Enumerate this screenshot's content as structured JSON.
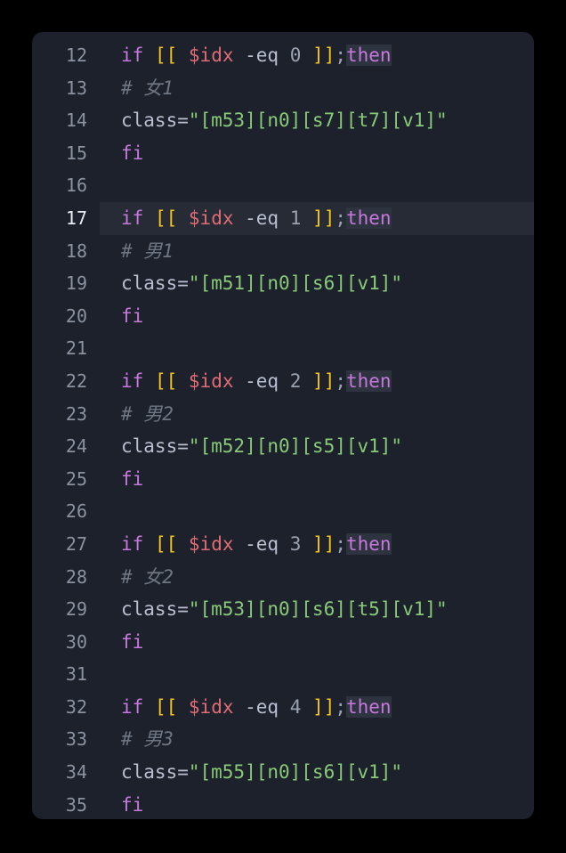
{
  "editor": {
    "background_color": "#1d212b",
    "page_background_color": "#000000",
    "active_line_number": 17,
    "first_line_number": 12,
    "last_line_number": 35,
    "language": "bash",
    "colors": {
      "keyword": "#c678dd",
      "bracket": "#f5c518",
      "variable": "#e06c75",
      "operator": "#b9bfd0",
      "number": "#9aa2b1",
      "string": "#89ca78",
      "comment": "#6f7683",
      "line_number": "#8b92a0",
      "line_number_active": "#e8ebf2",
      "active_line_background": "#272b35",
      "match_highlight_background": "#2e3340"
    }
  },
  "lines": [
    {
      "number": "12",
      "active": false,
      "tokens": [
        {
          "t": "if",
          "c": "kw"
        },
        {
          "t": " ",
          "c": "plain"
        },
        {
          "t": "[[",
          "c": "brkt"
        },
        {
          "t": " ",
          "c": "plain"
        },
        {
          "t": "$idx",
          "c": "var"
        },
        {
          "t": " ",
          "c": "plain"
        },
        {
          "t": "-eq",
          "c": "op"
        },
        {
          "t": " ",
          "c": "plain"
        },
        {
          "t": "0",
          "c": "num"
        },
        {
          "t": " ",
          "c": "plain"
        },
        {
          "t": "]]",
          "c": "brkt"
        },
        {
          "t": ";",
          "c": "punct"
        },
        {
          "t": "then",
          "c": "kw-hl"
        }
      ]
    },
    {
      "number": "13",
      "active": false,
      "tokens": [
        {
          "t": "# 女1",
          "c": "comment"
        }
      ]
    },
    {
      "number": "14",
      "active": false,
      "tokens": [
        {
          "t": "class=",
          "c": "plain"
        },
        {
          "t": "\"[m53][n0][s7][t7][v1]\"",
          "c": "str"
        }
      ]
    },
    {
      "number": "15",
      "active": false,
      "tokens": [
        {
          "t": "fi",
          "c": "kw"
        }
      ]
    },
    {
      "number": "16",
      "active": false,
      "tokens": []
    },
    {
      "number": "17",
      "active": true,
      "tokens": [
        {
          "t": "if",
          "c": "kw"
        },
        {
          "t": " ",
          "c": "plain"
        },
        {
          "t": "[[",
          "c": "brkt"
        },
        {
          "t": " ",
          "c": "plain"
        },
        {
          "t": "$idx",
          "c": "var"
        },
        {
          "t": " ",
          "c": "plain"
        },
        {
          "t": "-eq",
          "c": "op"
        },
        {
          "t": " ",
          "c": "plain"
        },
        {
          "t": "1",
          "c": "num"
        },
        {
          "t": " ",
          "c": "plain"
        },
        {
          "t": "]]",
          "c": "brkt"
        },
        {
          "t": ";",
          "c": "punct"
        },
        {
          "t": "then",
          "c": "kw-hl"
        }
      ]
    },
    {
      "number": "18",
      "active": false,
      "tokens": [
        {
          "t": "# 男1",
          "c": "comment"
        }
      ]
    },
    {
      "number": "19",
      "active": false,
      "tokens": [
        {
          "t": "class=",
          "c": "plain"
        },
        {
          "t": "\"[m51][n0][s6][v1]\"",
          "c": "str"
        }
      ]
    },
    {
      "number": "20",
      "active": false,
      "tokens": [
        {
          "t": "fi",
          "c": "kw"
        }
      ]
    },
    {
      "number": "21",
      "active": false,
      "tokens": []
    },
    {
      "number": "22",
      "active": false,
      "tokens": [
        {
          "t": "if",
          "c": "kw"
        },
        {
          "t": " ",
          "c": "plain"
        },
        {
          "t": "[[",
          "c": "brkt"
        },
        {
          "t": " ",
          "c": "plain"
        },
        {
          "t": "$idx",
          "c": "var"
        },
        {
          "t": " ",
          "c": "plain"
        },
        {
          "t": "-eq",
          "c": "op"
        },
        {
          "t": " ",
          "c": "plain"
        },
        {
          "t": "2",
          "c": "num"
        },
        {
          "t": " ",
          "c": "plain"
        },
        {
          "t": "]]",
          "c": "brkt"
        },
        {
          "t": ";",
          "c": "punct"
        },
        {
          "t": "then",
          "c": "kw-hl"
        }
      ]
    },
    {
      "number": "23",
      "active": false,
      "tokens": [
        {
          "t": "# 男2",
          "c": "comment"
        }
      ]
    },
    {
      "number": "24",
      "active": false,
      "tokens": [
        {
          "t": "class=",
          "c": "plain"
        },
        {
          "t": "\"[m52][n0][s5][v1]\"",
          "c": "str"
        }
      ]
    },
    {
      "number": "25",
      "active": false,
      "tokens": [
        {
          "t": "fi",
          "c": "kw"
        }
      ]
    },
    {
      "number": "26",
      "active": false,
      "tokens": []
    },
    {
      "number": "27",
      "active": false,
      "tokens": [
        {
          "t": "if",
          "c": "kw"
        },
        {
          "t": " ",
          "c": "plain"
        },
        {
          "t": "[[",
          "c": "brkt"
        },
        {
          "t": " ",
          "c": "plain"
        },
        {
          "t": "$idx",
          "c": "var"
        },
        {
          "t": " ",
          "c": "plain"
        },
        {
          "t": "-eq",
          "c": "op"
        },
        {
          "t": " ",
          "c": "plain"
        },
        {
          "t": "3",
          "c": "num"
        },
        {
          "t": " ",
          "c": "plain"
        },
        {
          "t": "]]",
          "c": "brkt"
        },
        {
          "t": ";",
          "c": "punct"
        },
        {
          "t": "then",
          "c": "kw-hl"
        }
      ]
    },
    {
      "number": "28",
      "active": false,
      "tokens": [
        {
          "t": "# 女2",
          "c": "comment"
        }
      ]
    },
    {
      "number": "29",
      "active": false,
      "tokens": [
        {
          "t": "class=",
          "c": "plain"
        },
        {
          "t": "\"[m53][n0][s6][t5][v1]\"",
          "c": "str"
        }
      ]
    },
    {
      "number": "30",
      "active": false,
      "tokens": [
        {
          "t": "fi",
          "c": "kw"
        }
      ]
    },
    {
      "number": "31",
      "active": false,
      "tokens": []
    },
    {
      "number": "32",
      "active": false,
      "tokens": [
        {
          "t": "if",
          "c": "kw"
        },
        {
          "t": " ",
          "c": "plain"
        },
        {
          "t": "[[",
          "c": "brkt"
        },
        {
          "t": " ",
          "c": "plain"
        },
        {
          "t": "$idx",
          "c": "var"
        },
        {
          "t": " ",
          "c": "plain"
        },
        {
          "t": "-eq",
          "c": "op"
        },
        {
          "t": " ",
          "c": "plain"
        },
        {
          "t": "4",
          "c": "num"
        },
        {
          "t": " ",
          "c": "plain"
        },
        {
          "t": "]]",
          "c": "brkt"
        },
        {
          "t": ";",
          "c": "punct"
        },
        {
          "t": "then",
          "c": "kw-hl"
        }
      ]
    },
    {
      "number": "33",
      "active": false,
      "tokens": [
        {
          "t": "# 男3",
          "c": "comment"
        }
      ]
    },
    {
      "number": "34",
      "active": false,
      "tokens": [
        {
          "t": "class=",
          "c": "plain"
        },
        {
          "t": "\"[m55][n0][s6][v1]\"",
          "c": "str"
        }
      ]
    },
    {
      "number": "35",
      "active": false,
      "tokens": [
        {
          "t": "fi",
          "c": "kw"
        }
      ]
    }
  ]
}
